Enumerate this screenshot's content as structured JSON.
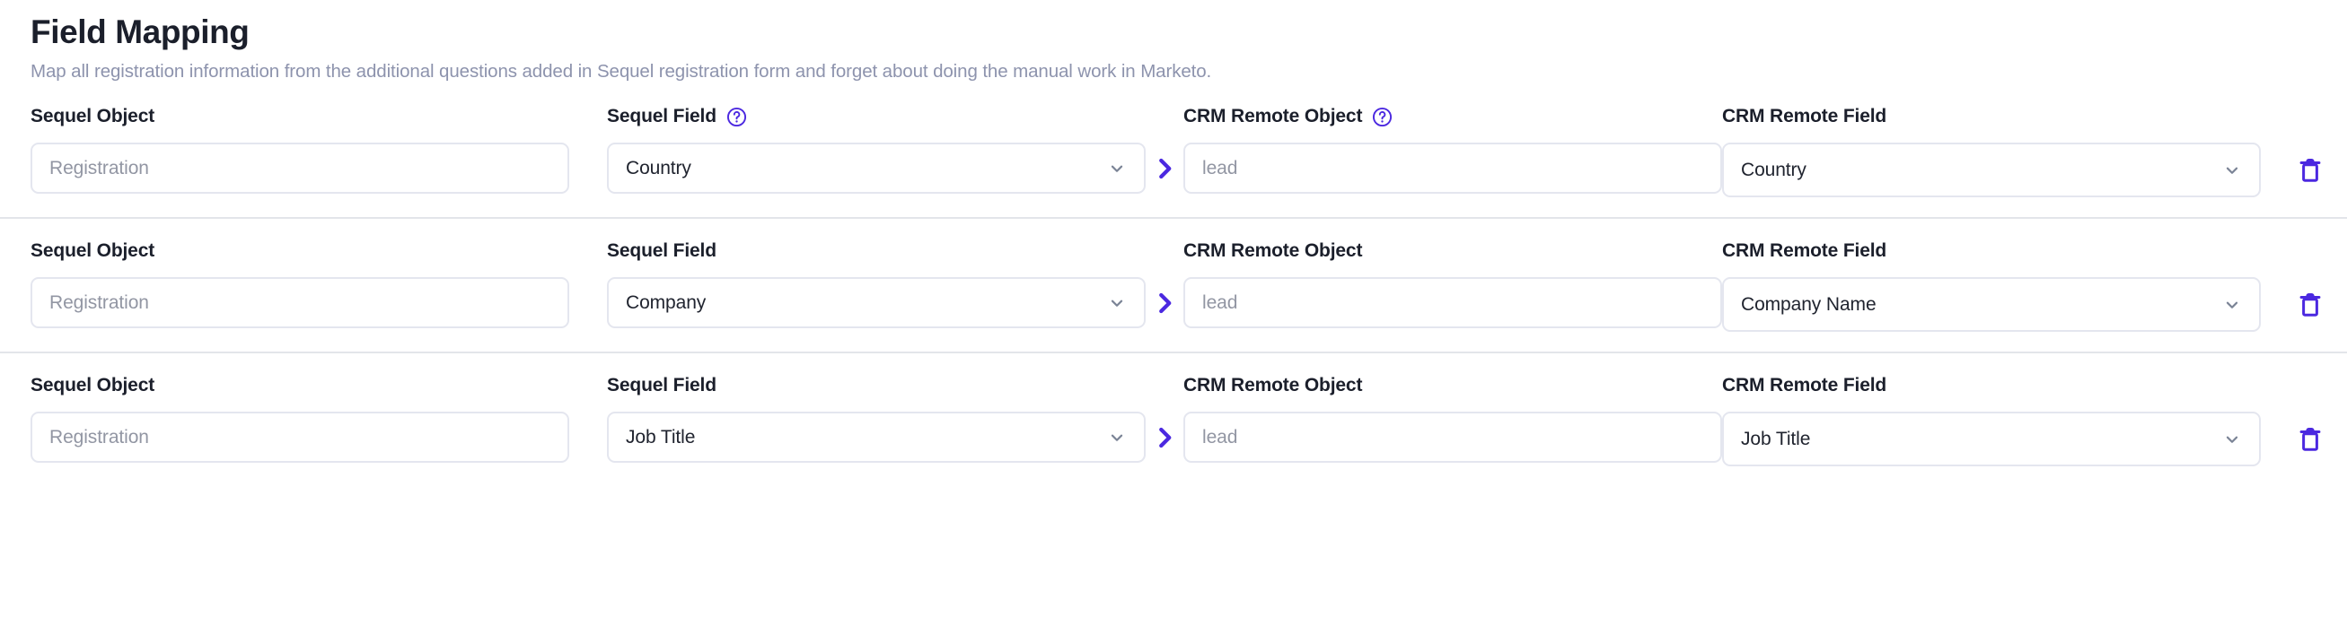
{
  "header": {
    "title": "Field Mapping",
    "subtitle": "Map all registration information from the additional questions added in Sequel registration form and forget about doing the manual work in Marketo."
  },
  "colors": {
    "accent": "#4b28e0",
    "border": "#e4e6ef",
    "divider": "#e3e5ea",
    "muted_text": "#8d93ad",
    "placeholder": "#9296a3",
    "chevron": "#7b8496",
    "title": "#1b1f2b"
  },
  "icons": {
    "help": "help-circle-icon",
    "chevron_down": "chevron-down-icon",
    "arrow_right": "chevron-right-icon",
    "delete": "trash-icon"
  },
  "labels": {
    "sequel_object": "Sequel Object",
    "sequel_field": "Sequel Field",
    "crm_remote_object": "CRM Remote Object",
    "crm_remote_field": "CRM Remote Field"
  },
  "rows": [
    {
      "sequel_object": {
        "label": "Sequel Object",
        "placeholder": "Registration",
        "value": ""
      },
      "sequel_field": {
        "label": "Sequel Field",
        "value": "Country",
        "has_help": true
      },
      "crm_remote_object": {
        "label": "CRM Remote Object",
        "placeholder": "lead",
        "value": "",
        "has_help": true
      },
      "crm_remote_field": {
        "label": "CRM Remote Field",
        "value": "Country"
      },
      "delete_label": "Delete mapping"
    },
    {
      "sequel_object": {
        "label": "Sequel Object",
        "placeholder": "Registration",
        "value": ""
      },
      "sequel_field": {
        "label": "Sequel Field",
        "value": "Company",
        "has_help": false
      },
      "crm_remote_object": {
        "label": "CRM Remote Object",
        "placeholder": "lead",
        "value": "",
        "has_help": false
      },
      "crm_remote_field": {
        "label": "CRM Remote Field",
        "value": "Company Name"
      },
      "delete_label": "Delete mapping"
    },
    {
      "sequel_object": {
        "label": "Sequel Object",
        "placeholder": "Registration",
        "value": ""
      },
      "sequel_field": {
        "label": "Sequel Field",
        "value": "Job Title",
        "has_help": false
      },
      "crm_remote_object": {
        "label": "CRM Remote Object",
        "placeholder": "lead",
        "value": "",
        "has_help": false
      },
      "crm_remote_field": {
        "label": "CRM Remote Field",
        "value": "Job Title"
      },
      "delete_label": "Delete mapping"
    }
  ]
}
